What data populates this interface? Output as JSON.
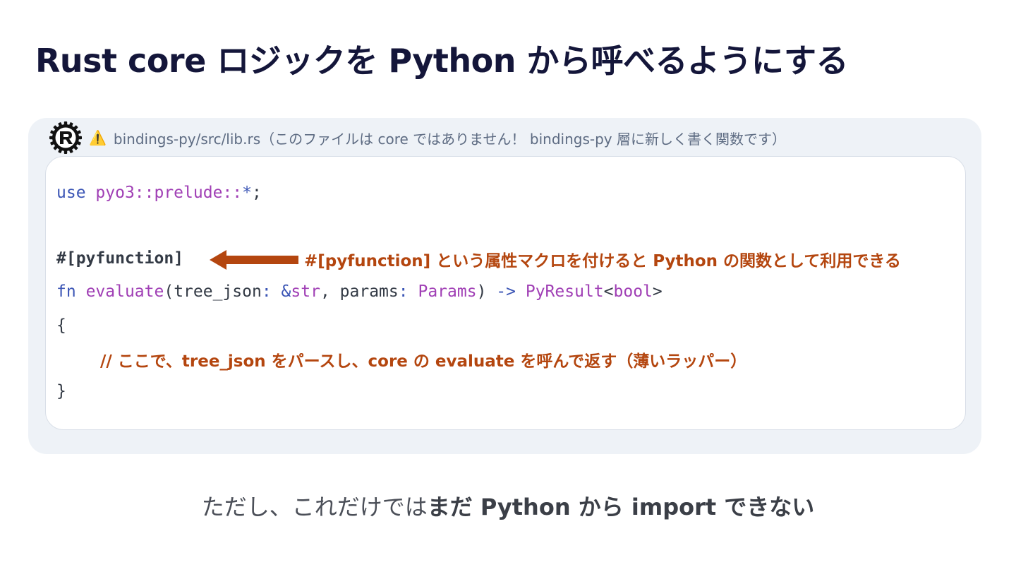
{
  "title": "Rust core ロジックを Python から呼べるようにする",
  "file_header": {
    "warning_icon": "⚠️",
    "text": "bindings-py/src/lib.rs（このファイルは core ではありません！ bindings-py 層に新しく書く関数です）",
    "logo": "rust-logo"
  },
  "code": {
    "line1": {
      "kw_use": "use",
      "module": "pyo3::prelude::",
      "star": "*",
      "semi": ";"
    },
    "line2": {
      "attribute": "#[pyfunction]"
    },
    "line3": {
      "kw_fn": "fn",
      "fn_name": "evaluate",
      "open": "(",
      "param1": "tree_json",
      "colon1": ":",
      "ref_amp": "&",
      "type_str": "str",
      "comma": ",",
      "param2": "params",
      "colon2": ":",
      "type_params": "Params",
      "close": ")",
      "arrow": "->",
      "ret_type": "PyResult",
      "lt": "<",
      "ret_inner": "bool",
      "gt": ">"
    },
    "line4": "{",
    "comment": "// ここで、tree_json をパースし、core の evaluate を呼んで返す（薄いラッパー）",
    "line6": "}"
  },
  "annotation": "#[pyfunction] という属性マクロを付けると Python の関数として利用できる",
  "footer": {
    "normal": "ただし、これだけでは",
    "bold": "まだ Python から import できない"
  },
  "colors": {
    "title": "#14163a",
    "panel_bg": "#eef2f7",
    "header_text": "#5d6b82",
    "keyword": "#3b55b5",
    "identifier": "#a03fb5",
    "accent": "#b4460f",
    "footer_text": "#4b4f58"
  }
}
